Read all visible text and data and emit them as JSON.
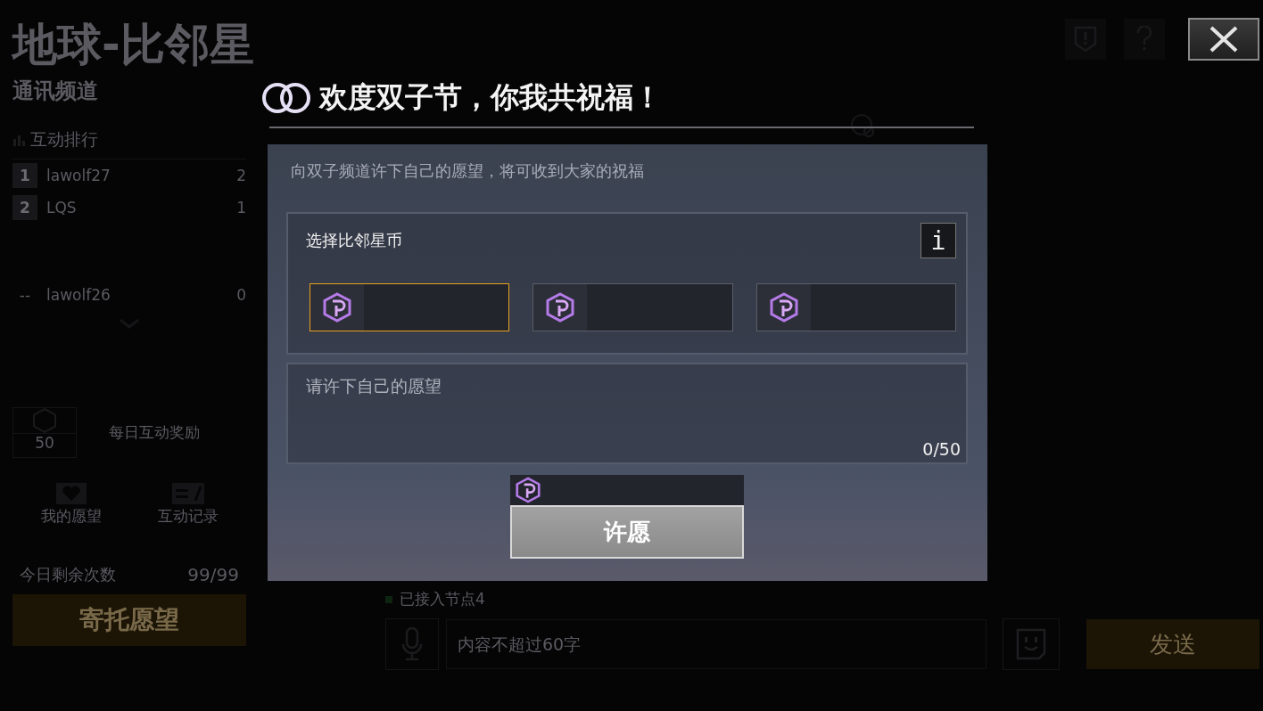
{
  "background": {
    "title": "地球-比邻星",
    "subtitle": "通讯频道",
    "ranking_title": "互动排行",
    "ranking": [
      {
        "rank": "1",
        "name": "lawolf27",
        "count": "2"
      },
      {
        "rank": "2",
        "name": "LQS",
        "count": "1"
      }
    ],
    "self_row": {
      "rank": "--",
      "name": "lawolf26",
      "count": "0"
    },
    "reward": {
      "amount": "50",
      "label": "每日互动奖励"
    },
    "tabs": [
      {
        "label": "我的愿望",
        "kind": "heart"
      },
      {
        "label": "互动记录",
        "kind": "record"
      }
    ],
    "remaining": {
      "label": "今日剩余次数",
      "value": "99/99"
    },
    "entrust_button": "寄托愿望",
    "status": "已接入节点4",
    "chat_input": {
      "placeholder": "内容不超过60字"
    },
    "send_button": "发送"
  },
  "dialog": {
    "title": "欢度双子节，你我共祝福！",
    "subtitle": "向双子频道许下自己的愿望，将可收到大家的祝福",
    "coin_label": "选择比邻星币",
    "info_button": "i",
    "coins": [
      {
        "selected": true
      },
      {
        "selected": false
      },
      {
        "selected": false
      }
    ],
    "wish_field": {
      "placeholder": "请许下自己的愿望"
    },
    "counter": "0/50",
    "submit_button": "许愿"
  }
}
